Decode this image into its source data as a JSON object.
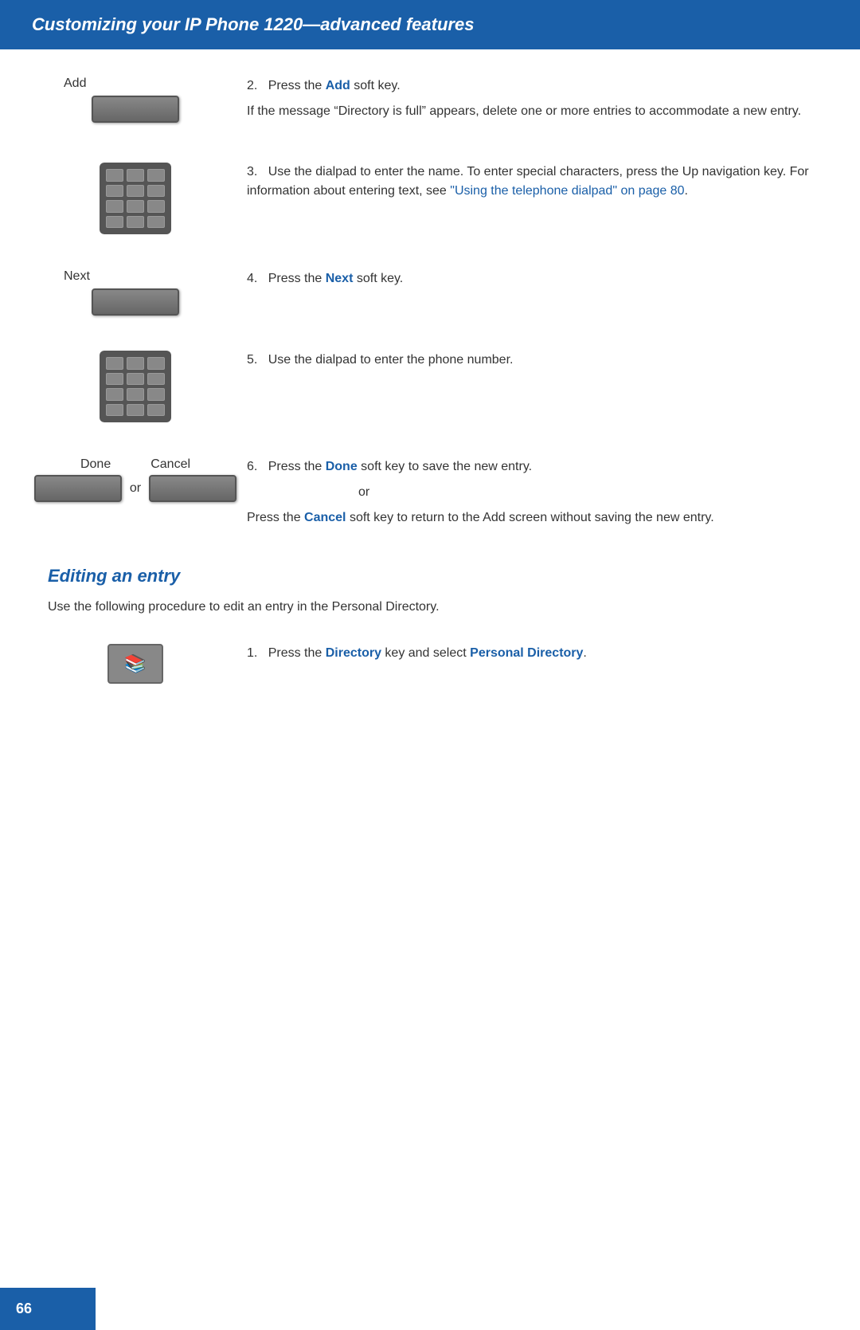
{
  "header": {
    "title": "Customizing your IP Phone 1220—advanced features"
  },
  "page_number": "66",
  "steps": [
    {
      "id": "step2",
      "number": "2.",
      "label": "Add",
      "has_label": true,
      "has_softkey": true,
      "has_dialpad": false,
      "has_directory": false,
      "main_text": "Press the ",
      "link_text": "Add",
      "after_link": " soft key.",
      "sub_text": "If the message “Directory is full” appears, delete one or more entries to accommodate a new entry."
    },
    {
      "id": "step3",
      "number": "3.",
      "label": "",
      "has_label": false,
      "has_softkey": false,
      "has_dialpad": true,
      "has_directory": false,
      "main_text": "Use the dialpad to enter the name. To enter special characters, press the Up navigation key. For information about entering text, see ",
      "link_text": "“Using the telephone dialpad” on page 80",
      "after_link": "."
    },
    {
      "id": "step4",
      "number": "4.",
      "label": "Next",
      "has_label": true,
      "has_softkey": true,
      "has_dialpad": false,
      "has_directory": false,
      "main_text": "Press the ",
      "link_text": "Next",
      "after_link": " soft key."
    },
    {
      "id": "step5",
      "number": "5.",
      "label": "",
      "has_label": false,
      "has_softkey": false,
      "has_dialpad": true,
      "has_directory": false,
      "main_text": "Use the dialpad to enter the phone number."
    },
    {
      "id": "step6",
      "number": "6.",
      "label_done": "Done",
      "label_cancel": "Cancel",
      "has_label": true,
      "has_done_cancel": true,
      "has_dialpad": false,
      "has_directory": false,
      "main_text": "Press the ",
      "link_done": "Done",
      "after_done": " soft key to save the new entry.",
      "or_text": "or",
      "press_cancel_text": "Press the ",
      "link_cancel": "Cancel",
      "after_cancel": " soft key to return to the Add screen without saving the new entry."
    }
  ],
  "editing_section": {
    "heading": "Editing an entry",
    "intro": "Use the following procedure to edit an entry in the Personal Directory.",
    "step1": {
      "number": "1.",
      "main_text": "Press the ",
      "link_directory": "Directory",
      "middle_text": " key and select ",
      "link_personal": "Personal Directory",
      "after_text": "."
    }
  }
}
